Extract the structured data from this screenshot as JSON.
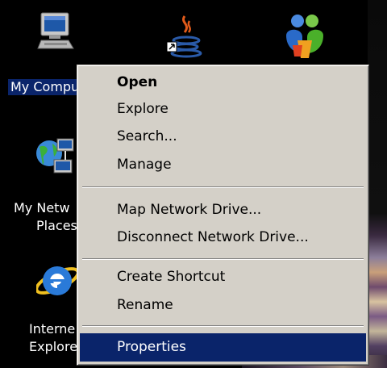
{
  "desktop": {
    "background_color": "#000000",
    "icons": {
      "my_computer": {
        "label": "My Compu",
        "icon": "computer-monitor-icon"
      },
      "java": {
        "icon": "java-cup-shortcut-icon"
      },
      "msn": {
        "icon": "msn-butterfly-icon"
      },
      "my_network": {
        "label_line1": "My Netw",
        "label_line2": "Places",
        "icon": "network-places-icon"
      },
      "internet_explorer": {
        "label_line1": "Interne",
        "label_line2": "Explore",
        "icon": "internet-explorer-icon"
      }
    }
  },
  "context_menu": {
    "background_color": "#d4d0c8",
    "highlight_color": "#0a246a",
    "items": [
      {
        "label": "Open",
        "bold": true
      },
      {
        "label": "Explore"
      },
      {
        "label": "Search..."
      },
      {
        "label": "Manage"
      },
      {
        "label": "Map Network Drive..."
      },
      {
        "label": "Disconnect Network Drive..."
      },
      {
        "label": "Create Shortcut"
      },
      {
        "label": "Rename"
      },
      {
        "label": "Properties",
        "highlighted": true
      }
    ]
  }
}
